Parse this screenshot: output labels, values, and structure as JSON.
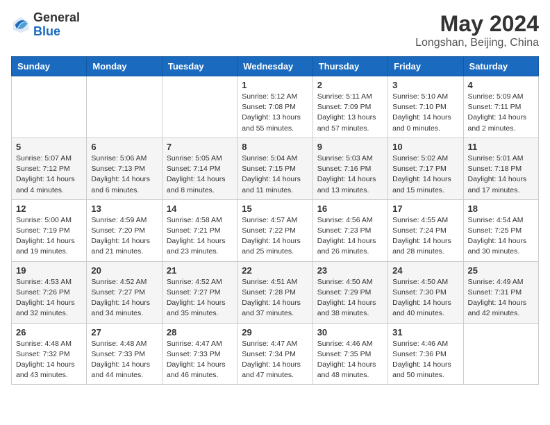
{
  "logo": {
    "general": "General",
    "blue": "Blue"
  },
  "header": {
    "month_year": "May 2024",
    "location": "Longshan, Beijing, China"
  },
  "weekdays": [
    "Sunday",
    "Monday",
    "Tuesday",
    "Wednesday",
    "Thursday",
    "Friday",
    "Saturday"
  ],
  "weeks": [
    [
      {
        "day": "",
        "info": ""
      },
      {
        "day": "",
        "info": ""
      },
      {
        "day": "",
        "info": ""
      },
      {
        "day": "1",
        "info": "Sunrise: 5:12 AM\nSunset: 7:08 PM\nDaylight: 13 hours\nand 55 minutes."
      },
      {
        "day": "2",
        "info": "Sunrise: 5:11 AM\nSunset: 7:09 PM\nDaylight: 13 hours\nand 57 minutes."
      },
      {
        "day": "3",
        "info": "Sunrise: 5:10 AM\nSunset: 7:10 PM\nDaylight: 14 hours\nand 0 minutes."
      },
      {
        "day": "4",
        "info": "Sunrise: 5:09 AM\nSunset: 7:11 PM\nDaylight: 14 hours\nand 2 minutes."
      }
    ],
    [
      {
        "day": "5",
        "info": "Sunrise: 5:07 AM\nSunset: 7:12 PM\nDaylight: 14 hours\nand 4 minutes."
      },
      {
        "day": "6",
        "info": "Sunrise: 5:06 AM\nSunset: 7:13 PM\nDaylight: 14 hours\nand 6 minutes."
      },
      {
        "day": "7",
        "info": "Sunrise: 5:05 AM\nSunset: 7:14 PM\nDaylight: 14 hours\nand 8 minutes."
      },
      {
        "day": "8",
        "info": "Sunrise: 5:04 AM\nSunset: 7:15 PM\nDaylight: 14 hours\nand 11 minutes."
      },
      {
        "day": "9",
        "info": "Sunrise: 5:03 AM\nSunset: 7:16 PM\nDaylight: 14 hours\nand 13 minutes."
      },
      {
        "day": "10",
        "info": "Sunrise: 5:02 AM\nSunset: 7:17 PM\nDaylight: 14 hours\nand 15 minutes."
      },
      {
        "day": "11",
        "info": "Sunrise: 5:01 AM\nSunset: 7:18 PM\nDaylight: 14 hours\nand 17 minutes."
      }
    ],
    [
      {
        "day": "12",
        "info": "Sunrise: 5:00 AM\nSunset: 7:19 PM\nDaylight: 14 hours\nand 19 minutes."
      },
      {
        "day": "13",
        "info": "Sunrise: 4:59 AM\nSunset: 7:20 PM\nDaylight: 14 hours\nand 21 minutes."
      },
      {
        "day": "14",
        "info": "Sunrise: 4:58 AM\nSunset: 7:21 PM\nDaylight: 14 hours\nand 23 minutes."
      },
      {
        "day": "15",
        "info": "Sunrise: 4:57 AM\nSunset: 7:22 PM\nDaylight: 14 hours\nand 25 minutes."
      },
      {
        "day": "16",
        "info": "Sunrise: 4:56 AM\nSunset: 7:23 PM\nDaylight: 14 hours\nand 26 minutes."
      },
      {
        "day": "17",
        "info": "Sunrise: 4:55 AM\nSunset: 7:24 PM\nDaylight: 14 hours\nand 28 minutes."
      },
      {
        "day": "18",
        "info": "Sunrise: 4:54 AM\nSunset: 7:25 PM\nDaylight: 14 hours\nand 30 minutes."
      }
    ],
    [
      {
        "day": "19",
        "info": "Sunrise: 4:53 AM\nSunset: 7:26 PM\nDaylight: 14 hours\nand 32 minutes."
      },
      {
        "day": "20",
        "info": "Sunrise: 4:52 AM\nSunset: 7:27 PM\nDaylight: 14 hours\nand 34 minutes."
      },
      {
        "day": "21",
        "info": "Sunrise: 4:52 AM\nSunset: 7:27 PM\nDaylight: 14 hours\nand 35 minutes."
      },
      {
        "day": "22",
        "info": "Sunrise: 4:51 AM\nSunset: 7:28 PM\nDaylight: 14 hours\nand 37 minutes."
      },
      {
        "day": "23",
        "info": "Sunrise: 4:50 AM\nSunset: 7:29 PM\nDaylight: 14 hours\nand 38 minutes."
      },
      {
        "day": "24",
        "info": "Sunrise: 4:50 AM\nSunset: 7:30 PM\nDaylight: 14 hours\nand 40 minutes."
      },
      {
        "day": "25",
        "info": "Sunrise: 4:49 AM\nSunset: 7:31 PM\nDaylight: 14 hours\nand 42 minutes."
      }
    ],
    [
      {
        "day": "26",
        "info": "Sunrise: 4:48 AM\nSunset: 7:32 PM\nDaylight: 14 hours\nand 43 minutes."
      },
      {
        "day": "27",
        "info": "Sunrise: 4:48 AM\nSunset: 7:33 PM\nDaylight: 14 hours\nand 44 minutes."
      },
      {
        "day": "28",
        "info": "Sunrise: 4:47 AM\nSunset: 7:33 PM\nDaylight: 14 hours\nand 46 minutes."
      },
      {
        "day": "29",
        "info": "Sunrise: 4:47 AM\nSunset: 7:34 PM\nDaylight: 14 hours\nand 47 minutes."
      },
      {
        "day": "30",
        "info": "Sunrise: 4:46 AM\nSunset: 7:35 PM\nDaylight: 14 hours\nand 48 minutes."
      },
      {
        "day": "31",
        "info": "Sunrise: 4:46 AM\nSunset: 7:36 PM\nDaylight: 14 hours\nand 50 minutes."
      },
      {
        "day": "",
        "info": ""
      }
    ]
  ]
}
